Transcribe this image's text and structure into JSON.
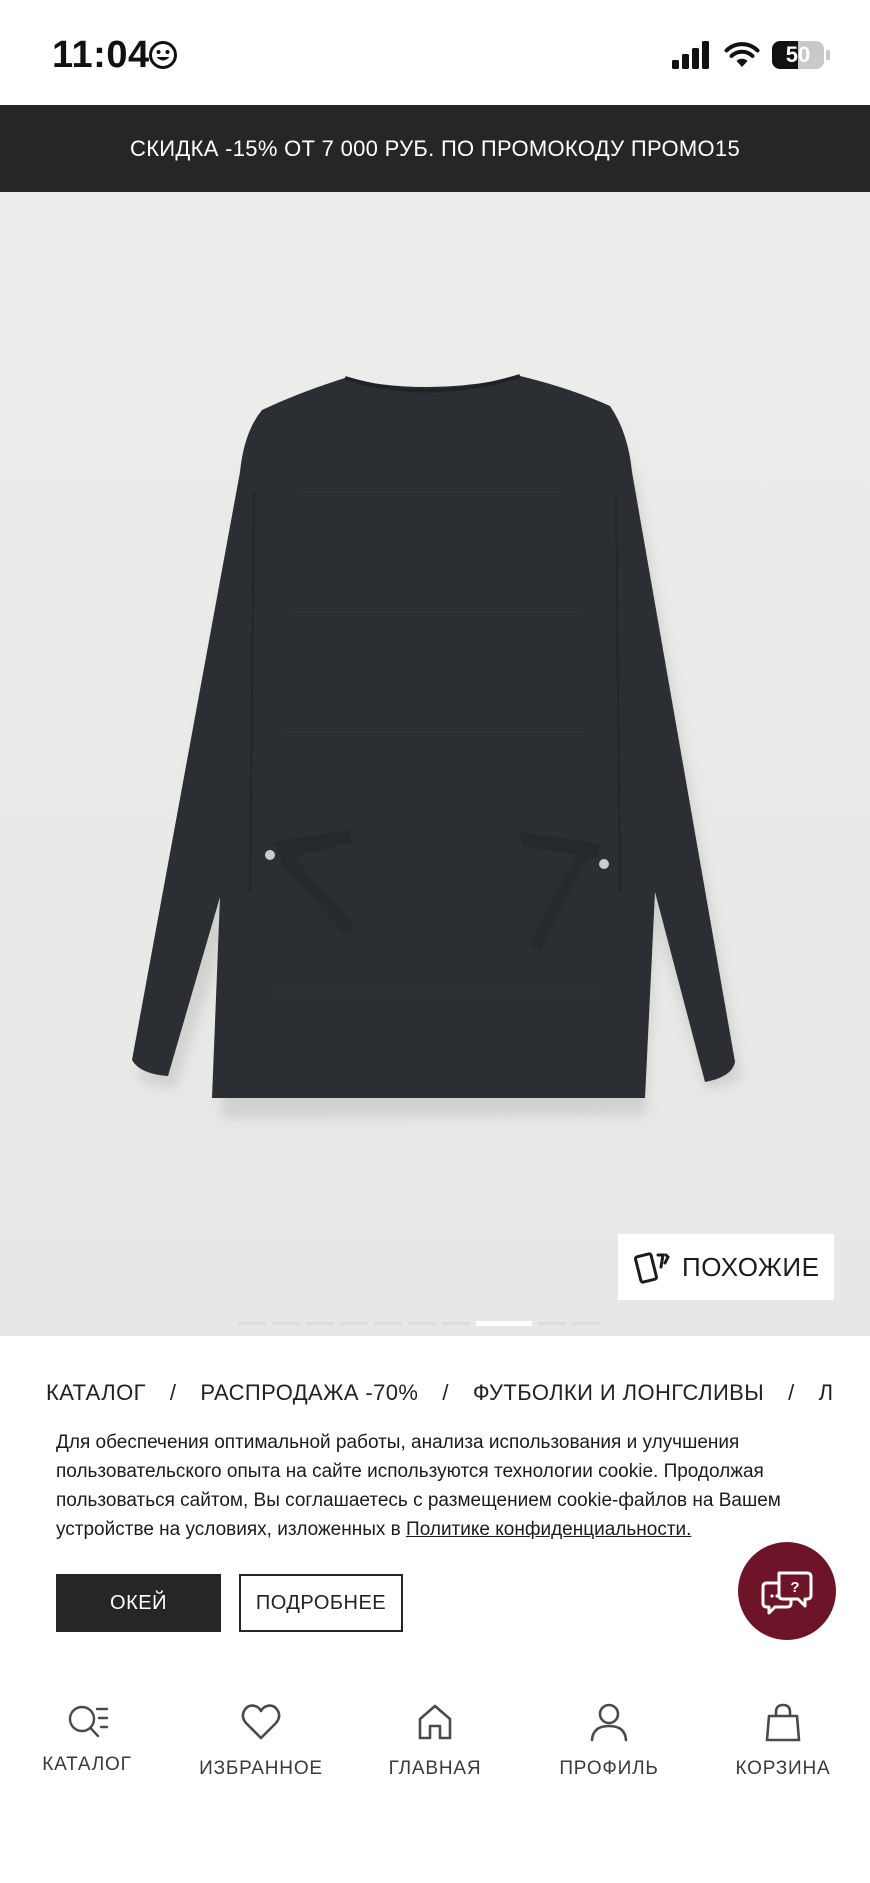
{
  "status_bar": {
    "time": "11:04",
    "battery_level": "50",
    "battery_fraction": 0.5
  },
  "promo": {
    "text": "СКИДКА -15% ОТ 7 000 РУБ. ПО ПРОМОКОДУ ПРОМО15"
  },
  "product": {
    "similar_label": "ПОХОЖИЕ",
    "image_count": 10,
    "active_image_index": 7
  },
  "breadcrumb": {
    "items": [
      "КАТАЛОГ",
      "РАСПРОДАЖА -70%",
      "ФУТБОЛКИ И ЛОНГСЛИВЫ",
      "Л"
    ],
    "separator": "/"
  },
  "cookie": {
    "text": "Для обеспечения оптимальной работы, анализа использования и улучшения пользовательского опыта на сайте используются технологии cookie. Продолжая пользоваться сайтом, Вы соглашаетесь с размещением cookie-файлов на Вашем устройстве на условиях, изложенных в ",
    "link": "Политике конфиденциальности.",
    "ok_label": "ОКЕЙ",
    "more_label": "ПОДРОБНЕЕ"
  },
  "bottom_nav": {
    "items": [
      {
        "label": "КАТАЛОГ",
        "icon": "search-catalog-icon"
      },
      {
        "label": "ИЗБРАННОЕ",
        "icon": "heart-icon"
      },
      {
        "label": "ГЛАВНАЯ",
        "icon": "home-icon"
      },
      {
        "label": "ПРОФИЛЬ",
        "icon": "person-icon"
      },
      {
        "label": "КОРЗИНА",
        "icon": "shopping-bag-icon"
      }
    ]
  },
  "colors": {
    "promo_bg": "#262626",
    "chat_button": "#6e1428",
    "garment": "#2b2e33"
  }
}
